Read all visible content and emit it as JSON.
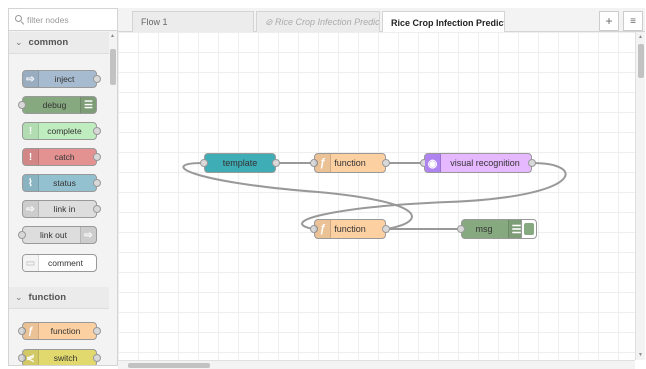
{
  "palette": {
    "filter_placeholder": "filter nodes",
    "categories": [
      {
        "label": "common",
        "chevron": "⌄"
      },
      {
        "label": "function",
        "chevron": "⌄"
      }
    ],
    "common_nodes": [
      {
        "label": "inject",
        "color": "#a6bbcf",
        "icon": "arrow-right-icon"
      },
      {
        "label": "debug",
        "color": "#87a980",
        "icon": "list-icon"
      },
      {
        "label": "complete",
        "color": "#c0edc0",
        "icon": "exclamation-icon"
      },
      {
        "label": "catch",
        "color": "#e49191",
        "icon": "exclamation-icon"
      },
      {
        "label": "status",
        "color": "#94c1d0",
        "icon": "pulse-icon"
      },
      {
        "label": "link in",
        "color": "#dddddd",
        "icon": "link-arrow-icon"
      },
      {
        "label": "link out",
        "color": "#dddddd",
        "icon": "link-arrow-icon"
      },
      {
        "label": "comment",
        "color": "#ffffff",
        "icon": "comment-icon"
      }
    ],
    "function_nodes": [
      {
        "label": "function",
        "color": "#fdd0a2",
        "icon": "function-icon"
      },
      {
        "label": "switch",
        "color": "#e2d96e",
        "icon": "switch-icon"
      }
    ]
  },
  "tabs": [
    {
      "label": "Flow 1",
      "state": "normal"
    },
    {
      "label": "⊘ Rice Crop Infection Predicti",
      "state": "disabled"
    },
    {
      "label": "Rice Crop Infection Predicti",
      "state": "active"
    }
  ],
  "tab_buttons": {
    "add": "+",
    "menu": "≡"
  },
  "flow": {
    "nodes": [
      {
        "id": "template",
        "label": "template",
        "color": "#3fadb5",
        "icon": "template-icon"
      },
      {
        "id": "function1",
        "label": "function",
        "color": "#fdd0a2",
        "icon": "function-icon"
      },
      {
        "id": "visual",
        "label": "visual recognition",
        "color": "#e6b8ff",
        "icon": "watson-icon"
      },
      {
        "id": "function2",
        "label": "function",
        "color": "#fdd0a2",
        "icon": "function-icon"
      },
      {
        "id": "debug",
        "label": "msg",
        "color": "#87a980",
        "icon": "list-icon"
      }
    ]
  }
}
